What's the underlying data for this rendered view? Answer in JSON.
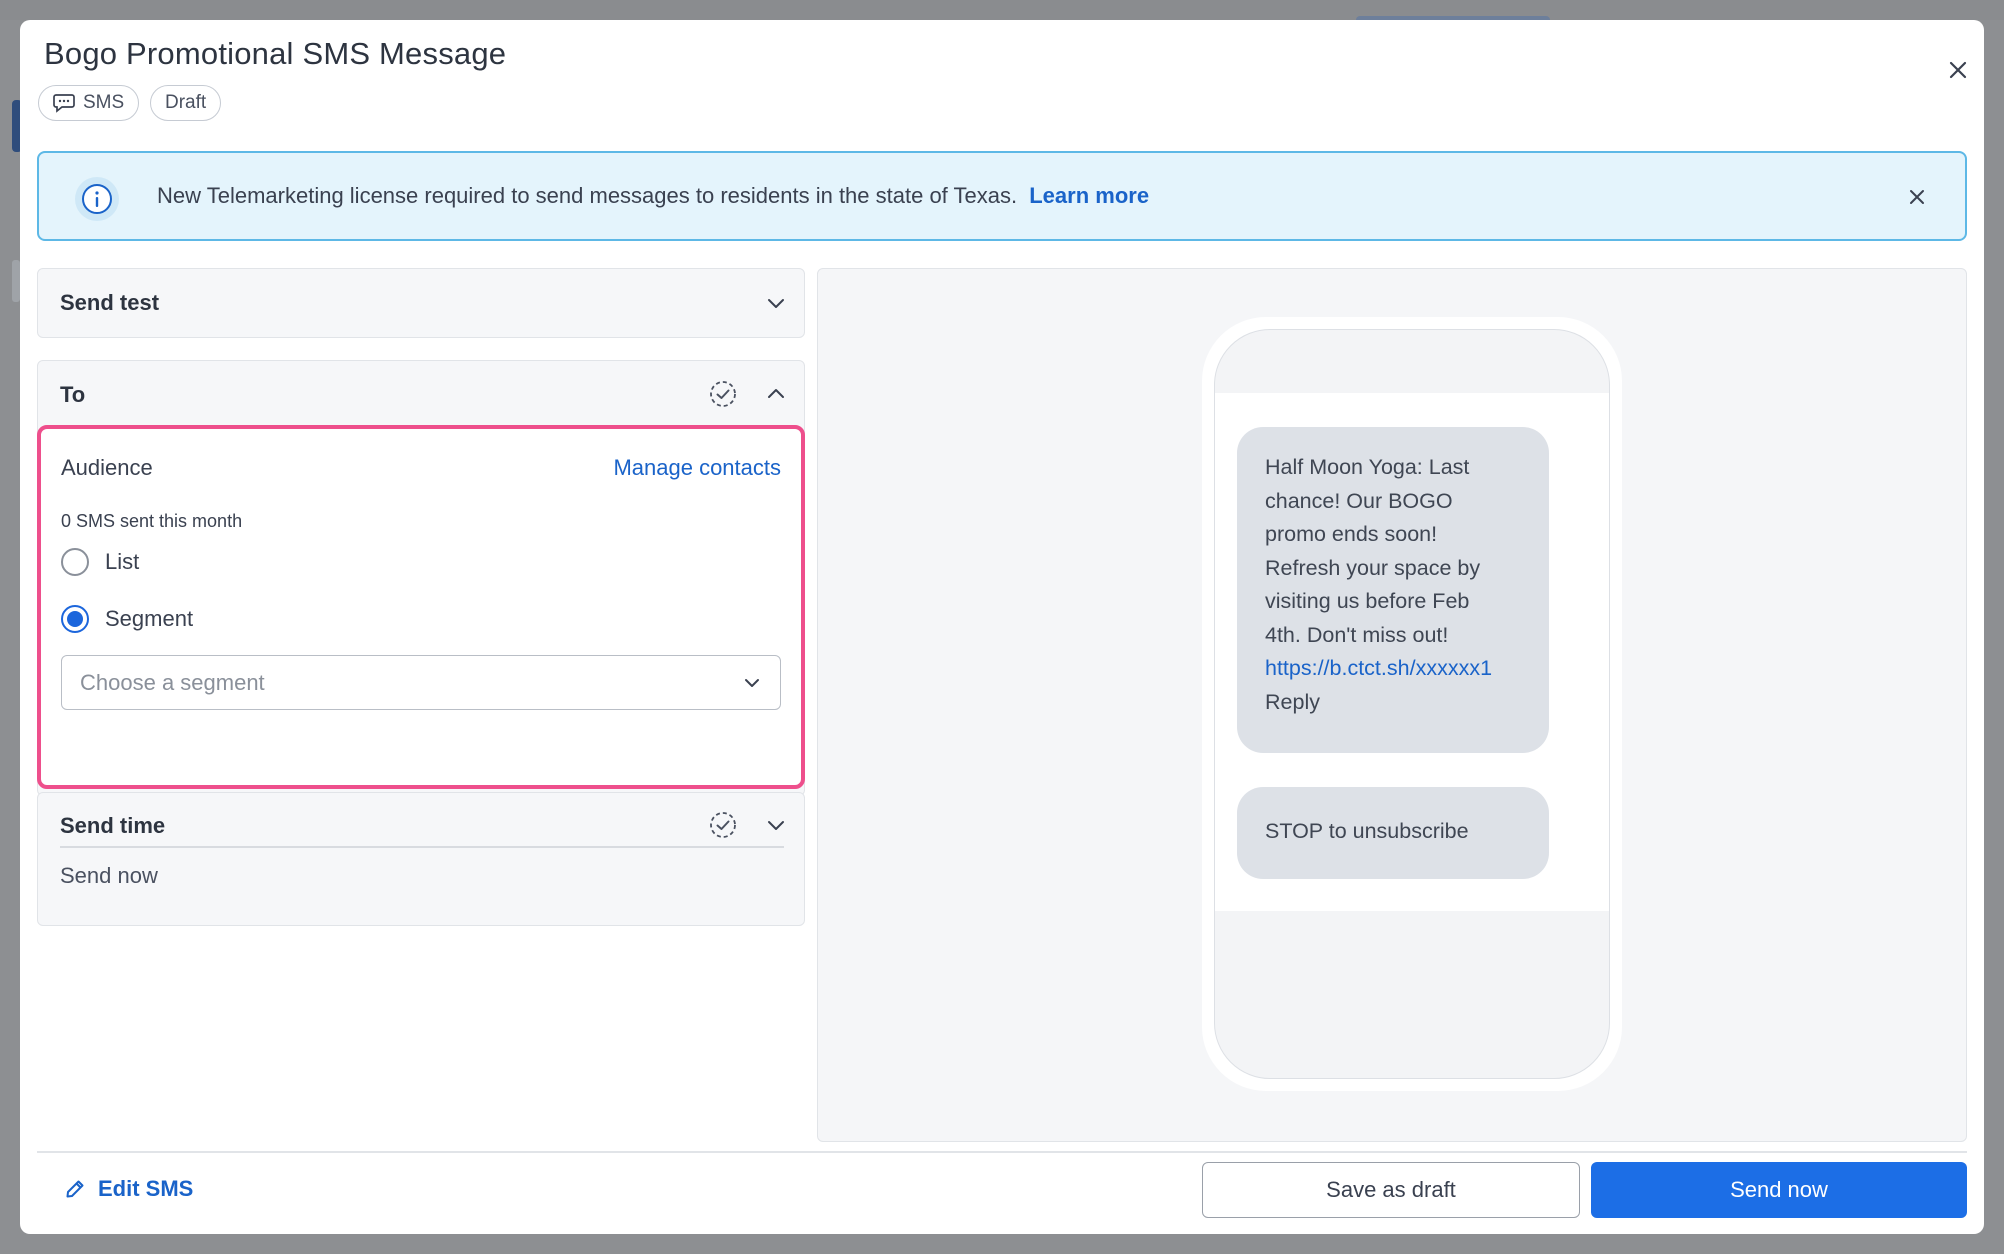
{
  "modal": {
    "title": "Bogo Promotional SMS Message",
    "chips": {
      "sms": "SMS",
      "draft": "Draft"
    }
  },
  "banner": {
    "text": "New Telemarketing license required to send messages to residents in the state of Texas.",
    "link": "Learn more",
    "icon": "info-icon",
    "bg_color": "#e4f4fc",
    "border_color": "#5db8e6"
  },
  "sections": {
    "send_test": {
      "title": "Send test"
    },
    "to": {
      "title": "To"
    },
    "send_time": {
      "title": "Send time",
      "value": "Send now"
    }
  },
  "audience": {
    "label": "Audience",
    "manage_link": "Manage contacts",
    "sent_count": "0 SMS sent this month",
    "options": [
      {
        "label": "List",
        "selected": false
      },
      {
        "label": "Segment",
        "selected": true
      }
    ],
    "segment_placeholder": "Choose a segment",
    "highlight_color": "#ee4f8c"
  },
  "preview": {
    "message_lines": [
      "Half Moon Yoga: Last",
      "chance! Our BOGO",
      "promo ends soon!",
      "Refresh your space by",
      "visiting us before Feb",
      "4th. Don't miss out!"
    ],
    "message_link": "https://b.ctct.sh/xxxxxx1",
    "message_reply": "Reply",
    "stop_text": "STOP to unsubscribe"
  },
  "footer": {
    "edit_label": "Edit SMS",
    "save_draft_label": "Save as draft",
    "send_now_label": "Send now",
    "primary_color": "#1c6ee6",
    "link_color": "#1a63c9"
  }
}
